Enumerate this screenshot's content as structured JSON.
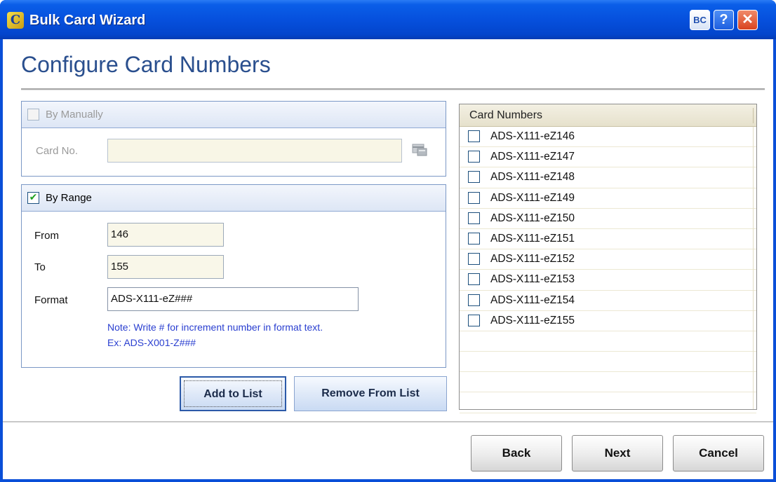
{
  "window": {
    "title": "Bulk Card Wizard",
    "app_icon_glyph": "C",
    "app_icon": "bulk-card-app-icon",
    "controls": {
      "bc_label": "BC",
      "help_label": "?",
      "close_label": "✕"
    }
  },
  "page": {
    "title": "Configure Card Numbers"
  },
  "manual": {
    "label": "By Manually",
    "checked": false,
    "card_no_label": "Card No.",
    "card_no_value": "",
    "card_icon": "card-icon"
  },
  "range": {
    "label": "By Range",
    "checked": true,
    "check_glyph": "✔",
    "from_label": "From",
    "from_value": "146",
    "to_label": "To",
    "to_value": "155",
    "format_label": "Format",
    "format_value": "ADS-X111-eZ###",
    "note_line1": "Note: Write # for increment number in format text.",
    "note_line2": "Ex: ADS-X001-Z###"
  },
  "actions": {
    "add_label": "Add to List",
    "remove_label": "Remove From List"
  },
  "list": {
    "header": "Card Numbers",
    "items": [
      "ADS-X111-eZ146",
      "ADS-X111-eZ147",
      "ADS-X111-eZ148",
      "ADS-X111-eZ149",
      "ADS-X111-eZ150",
      "ADS-X111-eZ151",
      "ADS-X111-eZ152",
      "ADS-X111-eZ153",
      "ADS-X111-eZ154",
      "ADS-X111-eZ155"
    ],
    "empty_rows": 4
  },
  "nav": {
    "back_label": "Back",
    "next_label": "Next",
    "cancel_label": "Cancel"
  },
  "colors": {
    "titlebar": "#0650dd",
    "heading": "#2a4f8e",
    "note": "#2a3fd0",
    "group_border": "#7b98c6",
    "check": "#21a121"
  }
}
